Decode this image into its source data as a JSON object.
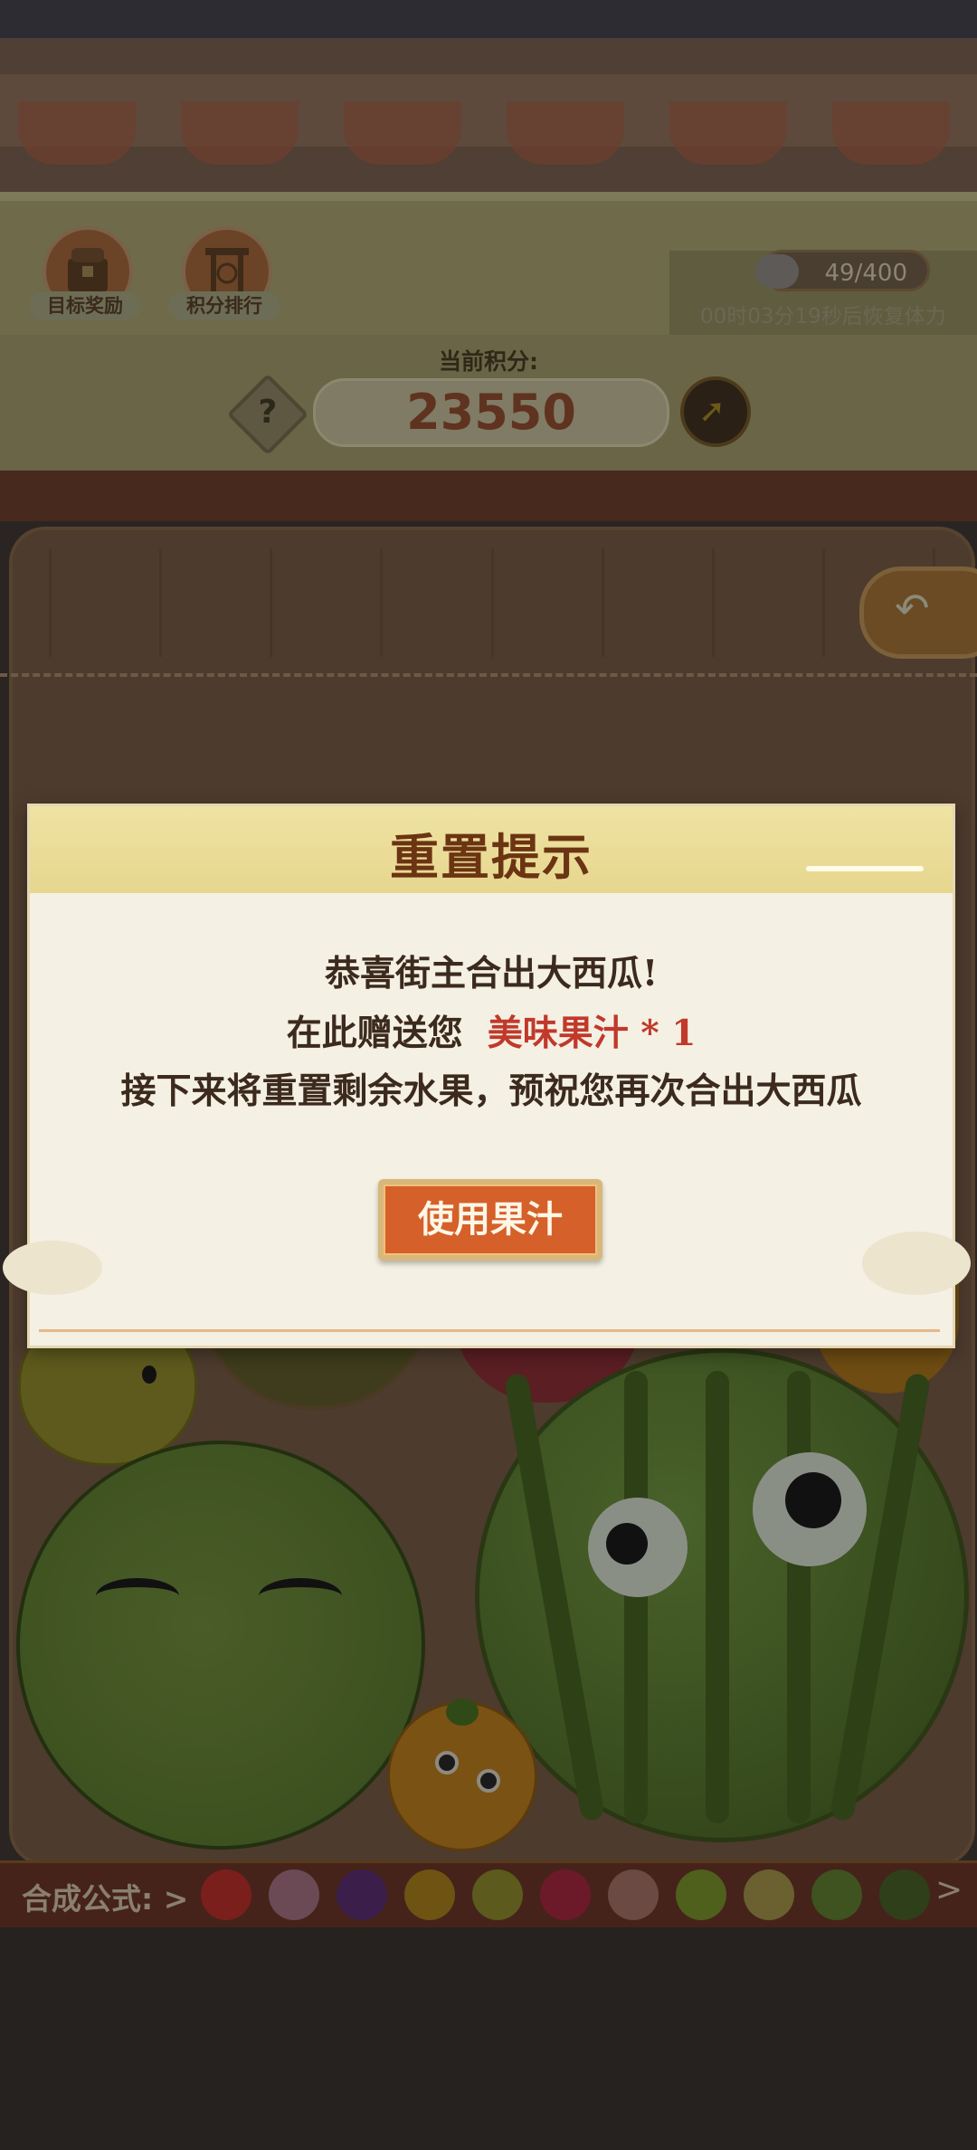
{
  "header": {
    "target_reward_label": "目标奖励",
    "rank_label": "积分排行",
    "stamina": "49/400",
    "recover_text": "00时03分19秒后恢复体力"
  },
  "score": {
    "label": "当前积分:",
    "value": "23550",
    "help_glyph": "?"
  },
  "modal": {
    "title": "重置提示",
    "line1": "恭喜街主合出大西瓜!",
    "line2_prefix": "在此赠送您",
    "line2_item": "美味果汁 * 1",
    "line3": "接下来将重置剩余水果，预祝您再次合出大西瓜",
    "button": "使用果汁"
  },
  "recipe": {
    "label": "合成公式:",
    "arrow": ">",
    "fruits": [
      "cherry",
      "grape-red",
      "grape-purple",
      "orange",
      "lemon",
      "apple",
      "peach",
      "kiwi",
      "pineapple",
      "melon",
      "watermelon"
    ],
    "colors": [
      "#7a1f1c",
      "#6b4a55",
      "#3b1f4a",
      "#6e5312",
      "#5c5a1c",
      "#6c1a2a",
      "#6a4a42",
      "#4f5f1c",
      "#6a6030",
      "#3e5320",
      "#2f3f1a"
    ]
  }
}
